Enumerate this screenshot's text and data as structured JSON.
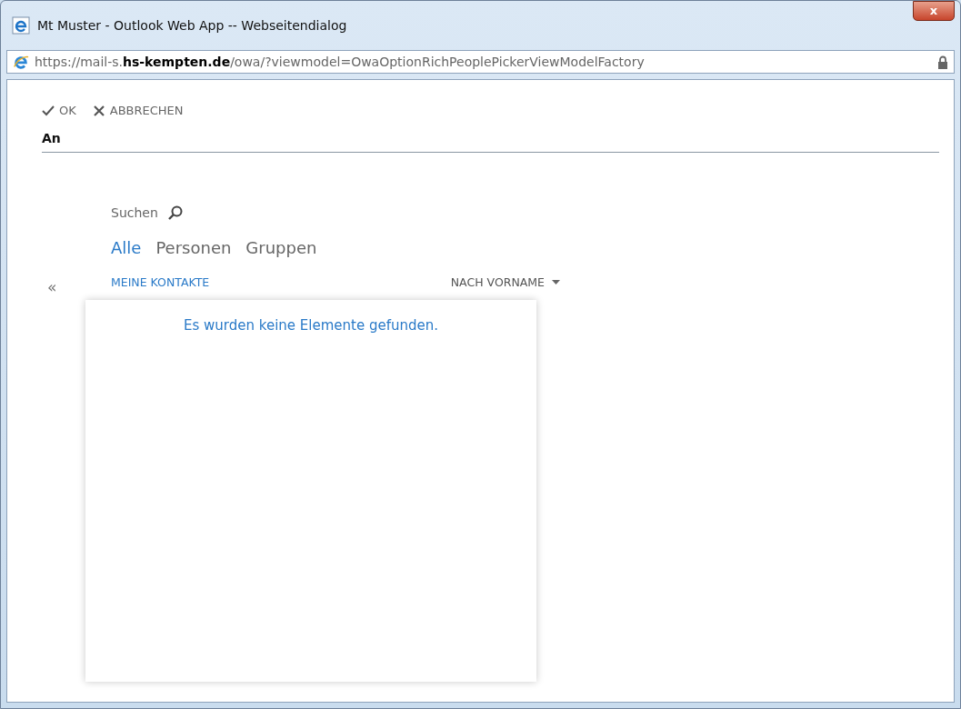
{
  "window": {
    "title": "Mt Muster - Outlook Web App -- Webseitendialog",
    "close_glyph": "x"
  },
  "address_bar": {
    "url": "https://mail-s.**hs-kempten.de**/owa/?viewmodel=OwaOptionRichPeoplePickerViewModelFactory"
  },
  "toolbar": [
    {
      "kind": "ok",
      "label": "OK"
    },
    {
      "kind": "cancel",
      "label": "ABBRECHEN"
    }
  ],
  "to_field": {
    "label": "An"
  },
  "collapse_glyph": "«",
  "search": {
    "placeholder": "Suchen"
  },
  "tabs": [
    {
      "label": "Alle",
      "selected": true
    },
    {
      "label": "Personen",
      "selected": false
    },
    {
      "label": "Gruppen",
      "selected": false
    }
  ],
  "folder": "MEINE KONTAKTE",
  "sort": "NACH VORNAME",
  "empty_message": "Es wurden keine Elemente gefunden."
}
